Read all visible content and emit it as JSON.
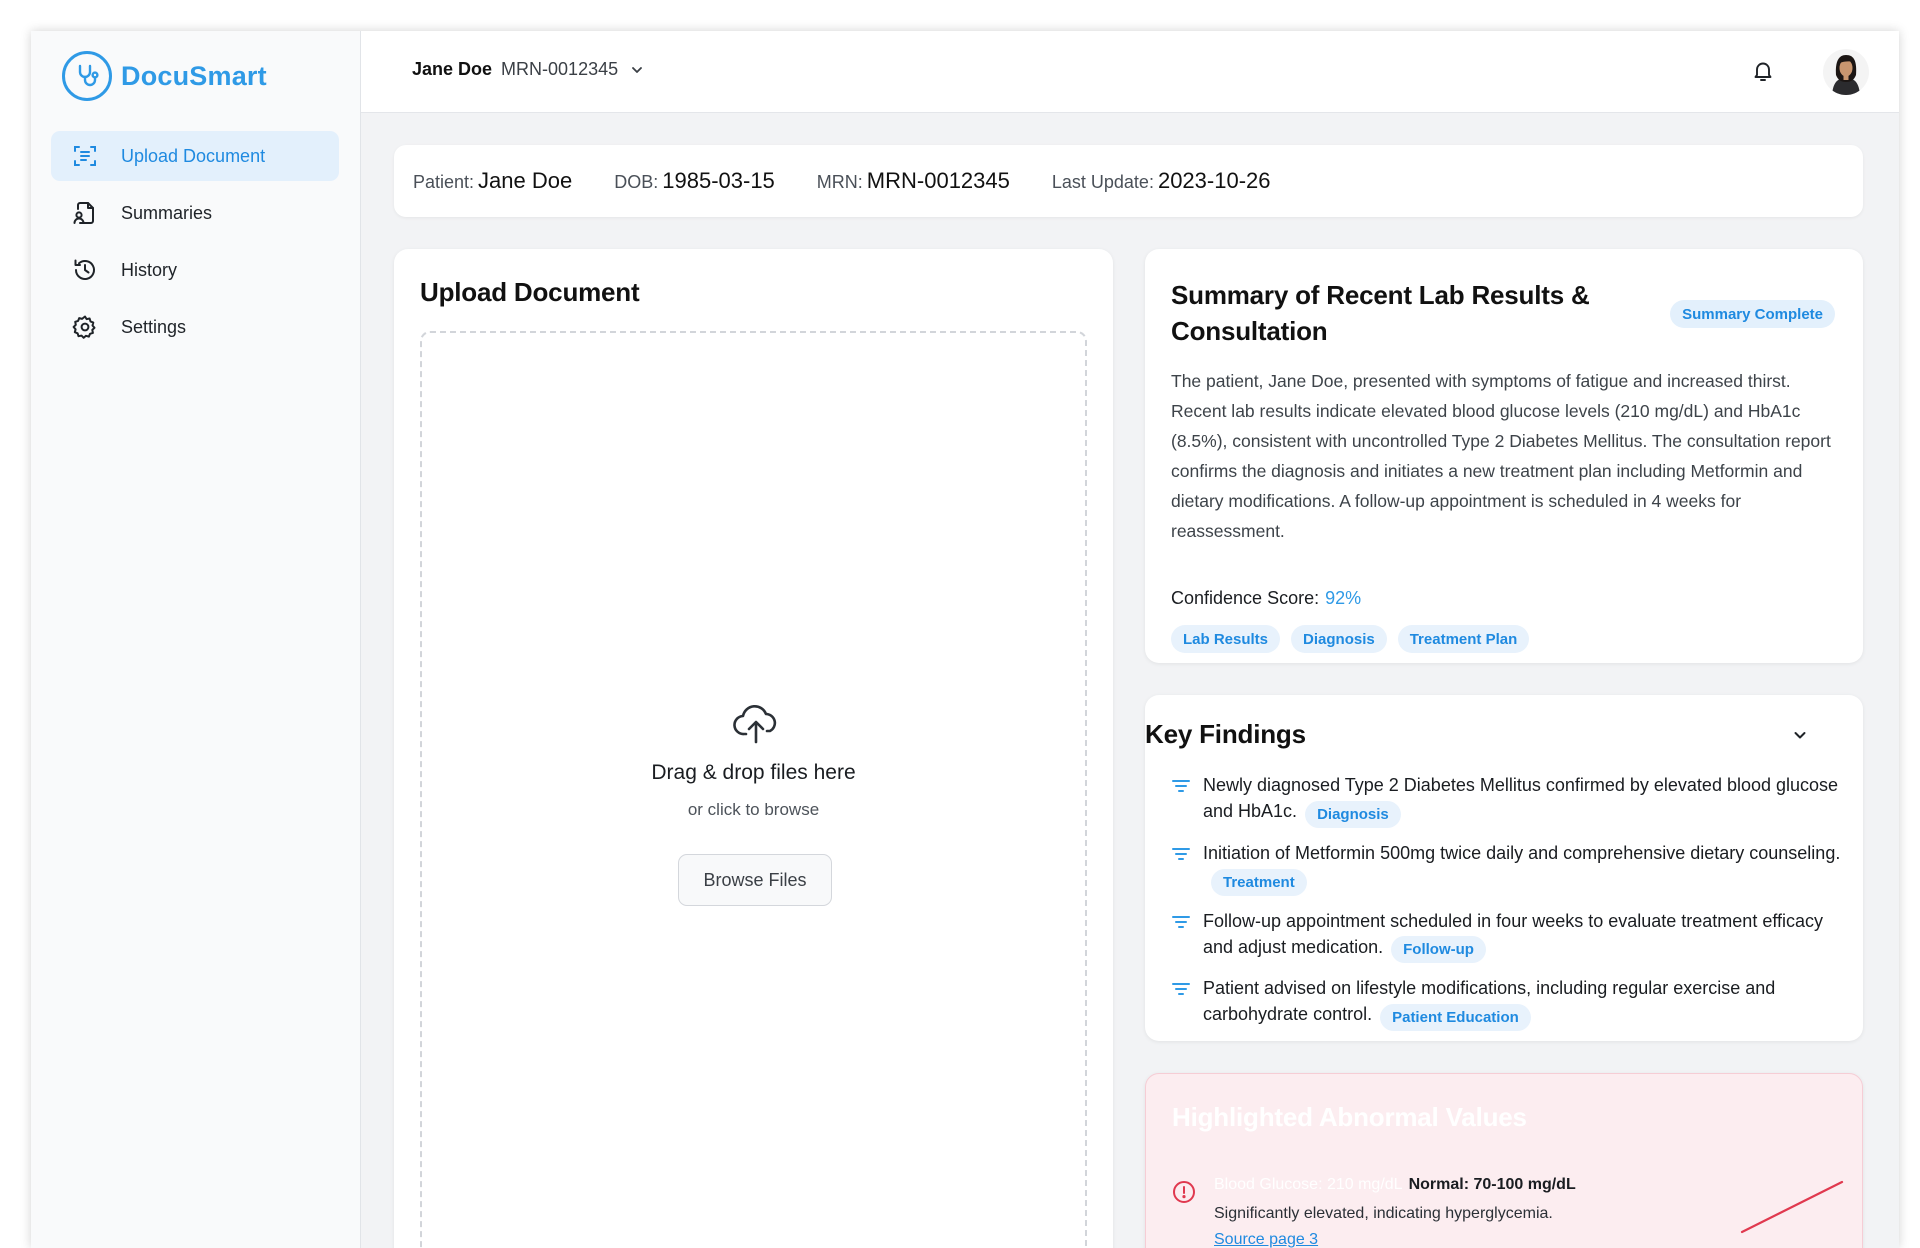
{
  "app": {
    "name": "DocuSmart",
    "brand_color": "#2f9ae6",
    "alert_color": "#e0394f"
  },
  "sidebar": {
    "items": [
      {
        "label": "Upload Document",
        "icon": "document-scan-icon",
        "active": true
      },
      {
        "label": "Summaries",
        "icon": "file-user-icon",
        "active": false
      },
      {
        "label": "History",
        "icon": "history-icon",
        "active": false
      },
      {
        "label": "Settings",
        "icon": "gear-icon",
        "active": false
      }
    ]
  },
  "header": {
    "patient_name": "Jane Doe",
    "patient_mrn": "MRN-0012345",
    "icons": [
      "chevron-down-icon",
      "bell-icon",
      "avatar"
    ]
  },
  "patient_info": {
    "patient_label": "Patient:",
    "patient_value": "Jane Doe",
    "dob_label": "DOB:",
    "dob_value": "1985-03-15",
    "mrn_label": "MRN:",
    "mrn_value": "MRN-0012345",
    "update_label": "Last Update:",
    "update_value": "2023-10-26"
  },
  "upload": {
    "title": "Upload Document",
    "drop_title": "Drag & drop files here",
    "drop_subtitle": "or click to browse",
    "browse_label": "Browse Files"
  },
  "summary": {
    "title": "Summary of Recent Lab Results & Consultation",
    "status": "Summary Complete",
    "text": "The patient, Jane Doe, presented with symptoms of fatigue and increased thirst. Recent lab results indicate elevated blood glucose levels (210 mg/dL) and HbA1c (8.5%), consistent with uncontrolled Type 2 Diabetes Mellitus. The consultation report confirms the diagnosis and initiates a new treatment plan including Metformin and dietary modifications. A follow-up appointment is scheduled in 4 weeks for reassessment.",
    "confidence_label": "Confidence Score:",
    "confidence_value": "92%",
    "tags": [
      "Lab Results",
      "Diagnosis",
      "Treatment Plan"
    ]
  },
  "key_findings": {
    "title": "Key Findings",
    "items": [
      {
        "text": "Newly diagnosed Type 2 Diabetes Mellitus confirmed by elevated blood glucose and HbA1c.",
        "tag": "Diagnosis"
      },
      {
        "text": "Initiation of Metformin 500mg twice daily and comprehensive dietary counseling.",
        "tag": "Treatment"
      },
      {
        "text": "Follow-up appointment scheduled in four weeks to evaluate treatment efficacy and adjust medication.",
        "tag": "Follow-up"
      },
      {
        "text": "Patient advised on lifestyle modifications, including regular exercise and carbohydrate control.",
        "tag": "Patient Education"
      }
    ]
  },
  "abnormal": {
    "title": "Highlighted Abnormal Values",
    "items": [
      {
        "name": "Blood Glucose: 210 mg/dL",
        "normal": "Normal: 70-100 mg/dL",
        "description": "Significantly elevated, indicating hyperglycemia.",
        "source": "Source page 3"
      }
    ]
  }
}
